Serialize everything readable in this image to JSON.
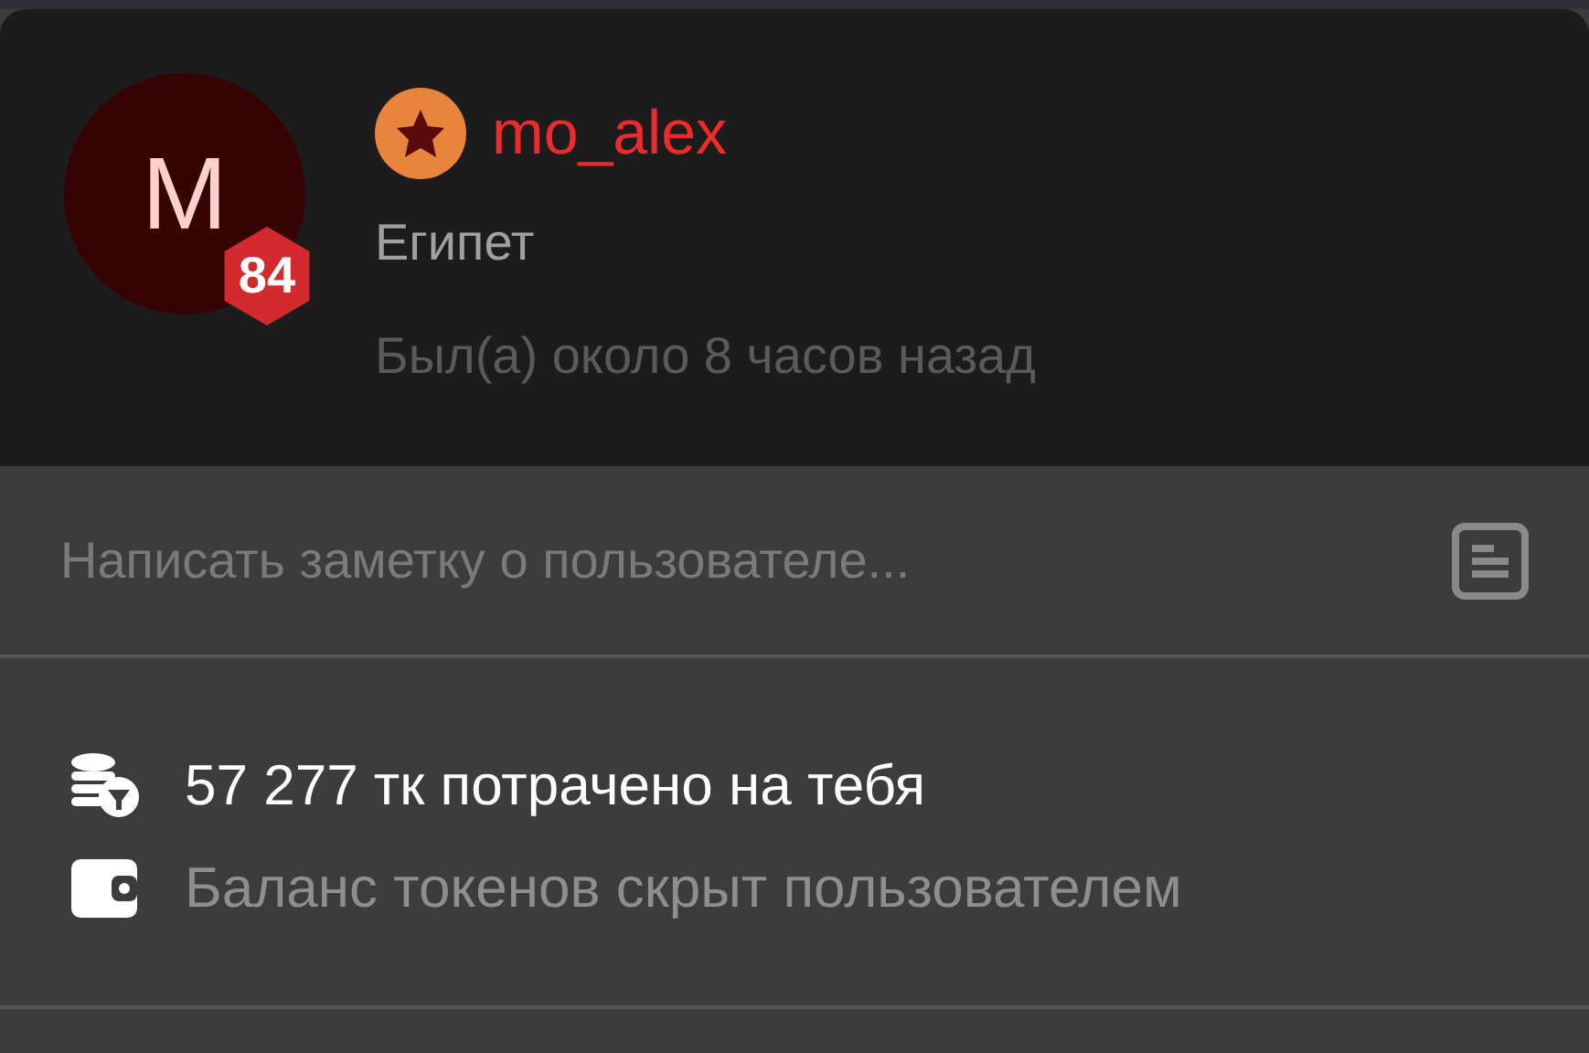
{
  "profile": {
    "avatar_letter": "M",
    "level": "84",
    "username": "mo_alex",
    "location": "Египет",
    "last_seen": "Был(а) около 8 часов назад"
  },
  "note": {
    "placeholder": "Написать заметку о пользователе..."
  },
  "stats": [
    {
      "kind": "spent",
      "text": "57 277 тк потрачено на тебя"
    },
    {
      "kind": "balance",
      "text": "Баланс токенов скрыт пользователем"
    }
  ]
}
